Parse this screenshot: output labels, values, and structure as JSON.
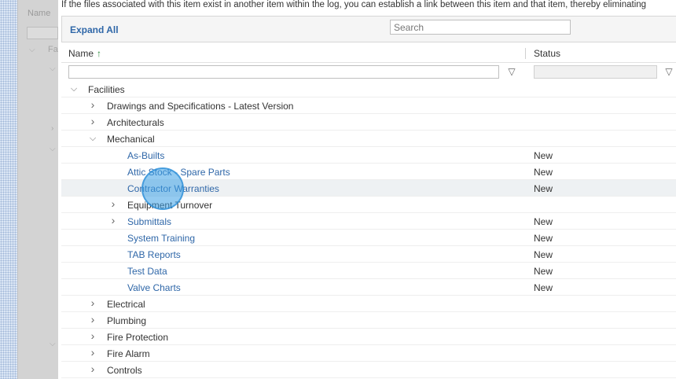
{
  "background": {
    "name_label": "Name",
    "facilities_abbrev": "Fa"
  },
  "info_text": "If the files associated with this item exist in another item within the log, you can establish a link between this item and that item, thereby eliminating",
  "toolbar": {
    "expand_all_label": "Expand All",
    "search_placeholder": "Search"
  },
  "columns": {
    "name": "Name",
    "sort_arrow": "↑",
    "status": "Status"
  },
  "rows": [
    {
      "label": "Facilities",
      "level": 0,
      "expand": "expanded",
      "type": "folder",
      "status": ""
    },
    {
      "label": "Drawings and Specifications - Latest Version",
      "level": 1,
      "expand": "collapsed",
      "type": "folder",
      "status": ""
    },
    {
      "label": "Architecturals",
      "level": 1,
      "expand": "collapsed",
      "type": "folder",
      "status": ""
    },
    {
      "label": "Mechanical",
      "level": 1,
      "expand": "expanded",
      "type": "folder",
      "status": ""
    },
    {
      "label": "As-Builts",
      "level": 2,
      "expand": "none",
      "type": "link",
      "status": "New"
    },
    {
      "label": "Attic Stock - Spare Parts",
      "level": 2,
      "expand": "none",
      "type": "link",
      "status": "New"
    },
    {
      "label": "Contractor Warranties",
      "level": 2,
      "expand": "none",
      "type": "link",
      "status": "New",
      "highlight": true
    },
    {
      "label": "Equipment Turnover",
      "level": 2,
      "expand": "collapsed",
      "type": "folder",
      "status": ""
    },
    {
      "label": "Submittals",
      "level": 2,
      "expand": "collapsed",
      "type": "link",
      "status": "New"
    },
    {
      "label": "System Training",
      "level": 2,
      "expand": "none",
      "type": "link",
      "status": "New"
    },
    {
      "label": "TAB Reports",
      "level": 2,
      "expand": "none",
      "type": "link",
      "status": "New"
    },
    {
      "label": "Test Data",
      "level": 2,
      "expand": "none",
      "type": "link",
      "status": "New"
    },
    {
      "label": "Valve Charts",
      "level": 2,
      "expand": "none",
      "type": "link",
      "status": "New"
    },
    {
      "label": "Electrical",
      "level": 1,
      "expand": "collapsed",
      "type": "folder",
      "status": ""
    },
    {
      "label": "Plumbing",
      "level": 1,
      "expand": "collapsed",
      "type": "folder",
      "status": ""
    },
    {
      "label": "Fire Protection",
      "level": 1,
      "expand": "collapsed",
      "type": "folder",
      "status": ""
    },
    {
      "label": "Fire Alarm",
      "level": 1,
      "expand": "collapsed",
      "type": "folder",
      "status": ""
    },
    {
      "label": "Controls",
      "level": 1,
      "expand": "collapsed",
      "type": "folder",
      "status": ""
    }
  ],
  "icons": {
    "collapsed": "chevron-right-icon",
    "expanded": "chevron-down-icon",
    "filter": "filter-icon"
  },
  "colors": {
    "link": "#2f67a8",
    "sort_arrow": "#2a8a3a",
    "click_indicator": "#3ca0e6"
  }
}
